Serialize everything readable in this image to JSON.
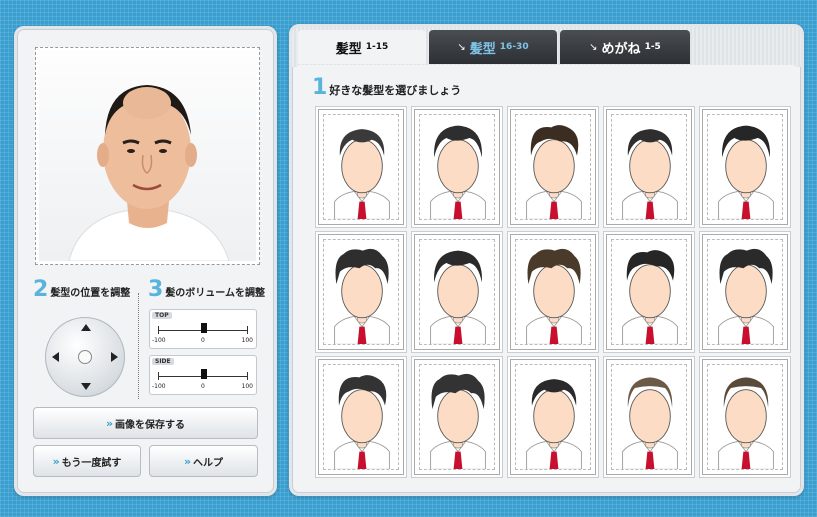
{
  "left": {
    "step2": {
      "num": "2",
      "label": "髪型の位置を調整"
    },
    "step3": {
      "num": "3",
      "label": "髪のボリュームを調整"
    },
    "sliders": [
      {
        "tag": "TOP",
        "min": "-100",
        "mid": "0",
        "max": "100",
        "value": 0
      },
      {
        "tag": "SIDE",
        "min": "-100",
        "mid": "0",
        "max": "100",
        "value": 0
      }
    ],
    "save_button": "画像を保存する",
    "retry_button": "もう一度試す",
    "help_button": "ヘルプ"
  },
  "tabs": [
    {
      "main": "髪型",
      "range": "1-15",
      "active": true
    },
    {
      "main": "髪型",
      "range": "16-30",
      "active": false
    },
    {
      "main": "めがね",
      "range": "1-5",
      "active": false
    }
  ],
  "step1": {
    "num": "1",
    "label": "好きな髪型を選びましょう"
  },
  "hairstyles": [
    {
      "hair": "#3a3a3a",
      "style": 0
    },
    {
      "hair": "#2e2e2e",
      "style": 1
    },
    {
      "hair": "#3b2d22",
      "style": 2
    },
    {
      "hair": "#2e2e2e",
      "style": 0
    },
    {
      "hair": "#262626",
      "style": 1
    },
    {
      "hair": "#2e2e2e",
      "style": 3
    },
    {
      "hair": "#2a2a2a",
      "style": 1
    },
    {
      "hair": "#4a3a2a",
      "style": 3
    },
    {
      "hair": "#262626",
      "style": 2
    },
    {
      "hair": "#2a2a2a",
      "style": 3
    },
    {
      "hair": "#333333",
      "style": 2
    },
    {
      "hair": "#333333",
      "style": 3
    },
    {
      "hair": "#2a2a2a",
      "style": 0
    },
    {
      "hair": "#6b5a48",
      "style": 4
    },
    {
      "hair": "#5a4a3a",
      "style": 4
    }
  ],
  "colors": {
    "accent": "#58b4dc",
    "tie": "#c8102e",
    "skin": "#fcdcc4"
  }
}
